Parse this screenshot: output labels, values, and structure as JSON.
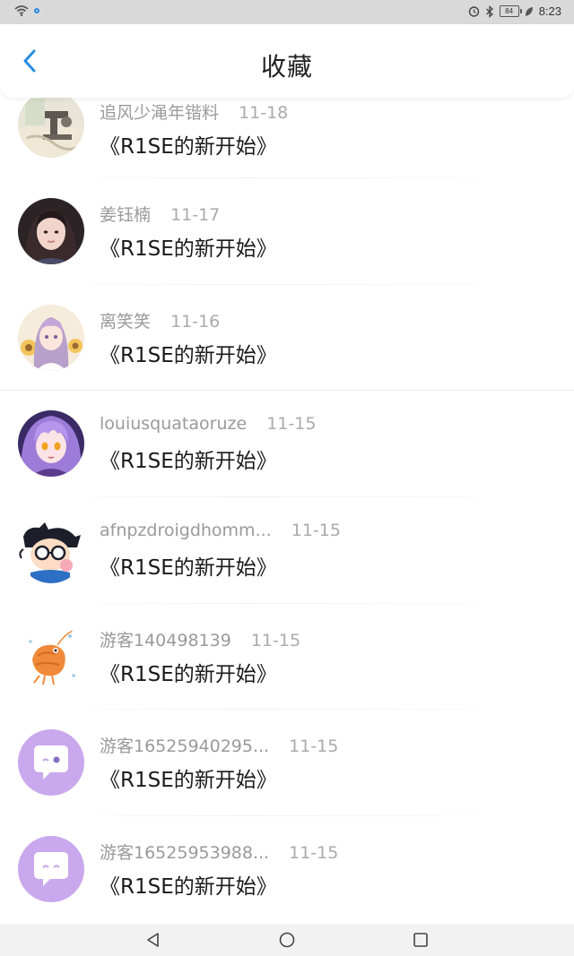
{
  "status_bar": {
    "time": "8:23",
    "battery": "84"
  },
  "header": {
    "title": "收藏"
  },
  "favorites": [
    {
      "user": "追风少渑年锴料",
      "date": "11-18",
      "title": "《R1SE的新开始》",
      "avatar": "photo-sewing-machine"
    },
    {
      "user": "姜钰楠",
      "date": "11-17",
      "title": "《R1SE的新开始》",
      "avatar": "photo-girl-portrait"
    },
    {
      "user": "离笑笑",
      "date": "11-16",
      "title": "《R1SE的新开始》",
      "avatar": "illustration-girl-sunflowers"
    },
    {
      "user": "louiusquataoruze",
      "date": "11-15",
      "title": "《R1SE的新开始》",
      "avatar": "anime-purple-hair"
    },
    {
      "user": "afnpzdroigdhomm...",
      "date": "11-15",
      "title": "《R1SE的新开始》",
      "avatar": "cartoon-boy-glasses"
    },
    {
      "user": "游客140498139",
      "date": "11-15",
      "title": "《R1SE的新开始》",
      "avatar": "cartoon-shrimp"
    },
    {
      "user": "游客16525940295...",
      "date": "11-15",
      "title": "《R1SE的新开始》",
      "avatar": "default-chat-bubble"
    },
    {
      "user": "游客16525953988...",
      "date": "11-15",
      "title": "《R1SE的新开始》",
      "avatar": "default-chat-bubble"
    }
  ],
  "colors": {
    "accent": "#2a8de0",
    "default_avatar": "#c9a8ee",
    "status_bar": "#d9d9d9",
    "nav_bar": "#f2f2f2"
  }
}
